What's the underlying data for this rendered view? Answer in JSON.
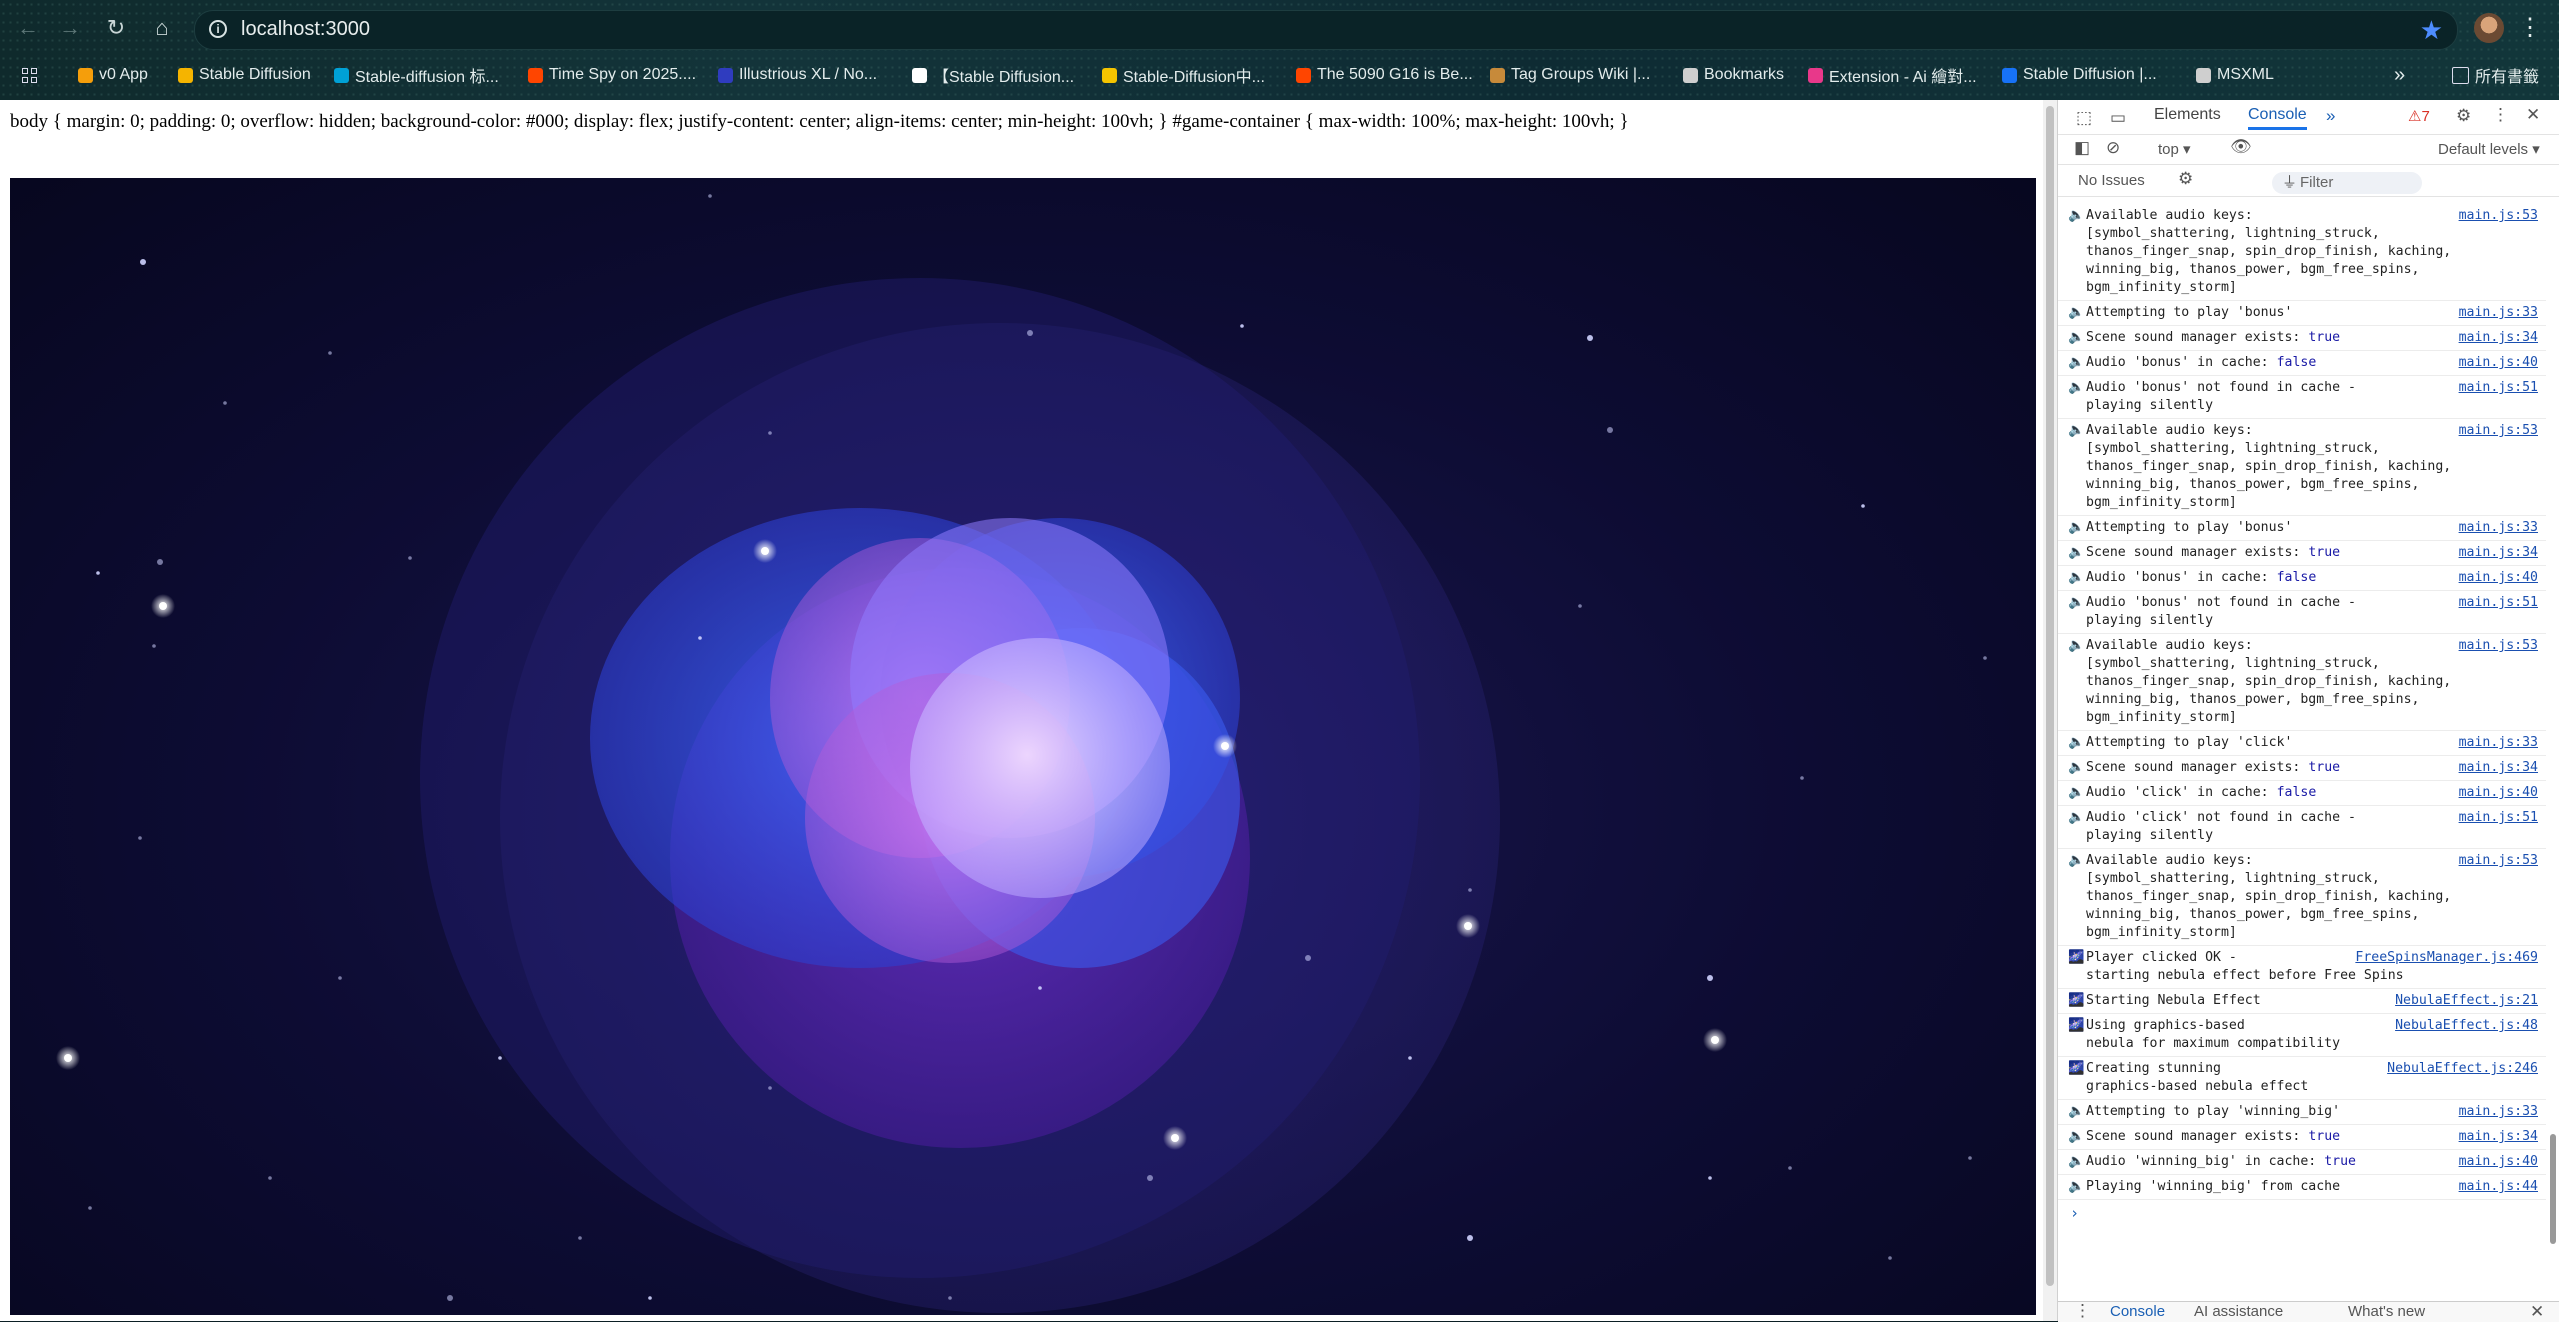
{
  "browser": {
    "url": "localhost:3000",
    "bookmarks": [
      {
        "label": "v0 App",
        "color": "#f59e0b"
      },
      {
        "label": "Stable Diffusion",
        "color": "#f5b400"
      },
      {
        "label": "Stable-diffusion 标...",
        "color": "#00a1d6"
      },
      {
        "label": "Time Spy on 2025....",
        "color": "#ff4500"
      },
      {
        "label": "Illustrious XL / No...",
        "color": "#2f3cbf"
      },
      {
        "label": "【Stable Diffusion...",
        "color": "#ffffff"
      },
      {
        "label": "Stable-Diffusion中...",
        "color": "#f5c400"
      },
      {
        "label": "The 5090 G16 is Be...",
        "color": "#ff4500"
      },
      {
        "label": "Tag Groups Wiki |...",
        "color": "#c78a3a"
      },
      {
        "label": "Bookmarks",
        "color": "#cfcfcf"
      },
      {
        "label": "Extension - Ai 繪對...",
        "color": "#e8388a"
      },
      {
        "label": "Stable Diffusion |...",
        "color": "#1772f6"
      },
      {
        "label": "MSXML",
        "color": "#cfcfcf"
      }
    ],
    "all_bookmarks_label": "所有書籤"
  },
  "page": {
    "css_text": "body { margin: 0; padding: 0; overflow: hidden; background-color: #000; display: flex; justify-content: center; align-items: center; min-height: 100vh; } #game-container { max-width: 100%; max-height: 100vh; }"
  },
  "devtools": {
    "tabs": [
      "Elements",
      "Console"
    ],
    "active_tab": "Console",
    "issue_count": "7",
    "context": "top",
    "filter_placeholder": "Filter",
    "levels": "Default levels",
    "no_issues": "No Issues",
    "drawer_tabs": [
      "Console",
      "AI assistance",
      "What's new"
    ],
    "logs": [
      {
        "icon": "🔈",
        "text": "Available audio keys:\n[symbol_shattering, lightning_struck,\nthanos_finger_snap, spin_drop_finish, kaching,\nwinning_big, thanos_power, bgm_free_spins,\nbgm_infinity_storm]",
        "src": "main.js:53"
      },
      {
        "icon": "🔈",
        "text": "Attempting to play 'bonus'",
        "src": "main.js:33"
      },
      {
        "icon": "🔈",
        "text": "Scene sound manager exists: true",
        "src": "main.js:34"
      },
      {
        "icon": "🔈",
        "text": "Audio 'bonus' in cache: false",
        "src": "main.js:40"
      },
      {
        "icon": "🔈",
        "text": "Audio 'bonus' not found in cache -\nplaying silently",
        "src": "main.js:51"
      },
      {
        "icon": "🔈",
        "text": "Available audio keys:\n[symbol_shattering, lightning_struck,\nthanos_finger_snap, spin_drop_finish, kaching,\nwinning_big, thanos_power, bgm_free_spins,\nbgm_infinity_storm]",
        "src": "main.js:53"
      },
      {
        "icon": "🔈",
        "text": "Attempting to play 'bonus'",
        "src": "main.js:33"
      },
      {
        "icon": "🔈",
        "text": "Scene sound manager exists: true",
        "src": "main.js:34"
      },
      {
        "icon": "🔈",
        "text": "Audio 'bonus' in cache: false",
        "src": "main.js:40"
      },
      {
        "icon": "🔈",
        "text": "Audio 'bonus' not found in cache -\nplaying silently",
        "src": "main.js:51"
      },
      {
        "icon": "🔈",
        "text": "Available audio keys:\n[symbol_shattering, lightning_struck,\nthanos_finger_snap, spin_drop_finish, kaching,\nwinning_big, thanos_power, bgm_free_spins,\nbgm_infinity_storm]",
        "src": "main.js:53"
      },
      {
        "icon": "🔈",
        "text": "Attempting to play 'click'",
        "src": "main.js:33"
      },
      {
        "icon": "🔈",
        "text": "Scene sound manager exists: true",
        "src": "main.js:34"
      },
      {
        "icon": "🔈",
        "text": "Audio 'click' in cache: false",
        "src": "main.js:40"
      },
      {
        "icon": "🔈",
        "text": "Audio 'click' not found in cache -\nplaying silently",
        "src": "main.js:51"
      },
      {
        "icon": "🔈",
        "text": "Available audio keys:\n[symbol_shattering, lightning_struck,\nthanos_finger_snap, spin_drop_finish, kaching,\nwinning_big, thanos_power, bgm_free_spins,\nbgm_infinity_storm]",
        "src": "main.js:53"
      },
      {
        "icon": "🌌",
        "text": "Player clicked OK -\nstarting nebula effect before Free Spins",
        "src": "FreeSpinsManager.js:469"
      },
      {
        "icon": "🌌",
        "text": "Starting Nebula Effect",
        "src": "NebulaEffect.js:21"
      },
      {
        "icon": "🌌",
        "text": "Using graphics-based\nnebula for maximum compatibility",
        "src": "NebulaEffect.js:48"
      },
      {
        "icon": "🌌",
        "text": "Creating stunning\ngraphics-based nebula effect",
        "src": "NebulaEffect.js:246"
      },
      {
        "icon": "🔈",
        "text": "Attempting to play 'winning_big'",
        "src": "main.js:33"
      },
      {
        "icon": "🔈",
        "text": "Scene sound manager exists: true",
        "src": "main.js:34"
      },
      {
        "icon": "🔈",
        "text": "Audio 'winning_big' in cache: true",
        "src": "main.js:40"
      },
      {
        "icon": "🔈",
        "text": "Playing 'winning_big' from cache",
        "src": "main.js:44"
      }
    ]
  }
}
